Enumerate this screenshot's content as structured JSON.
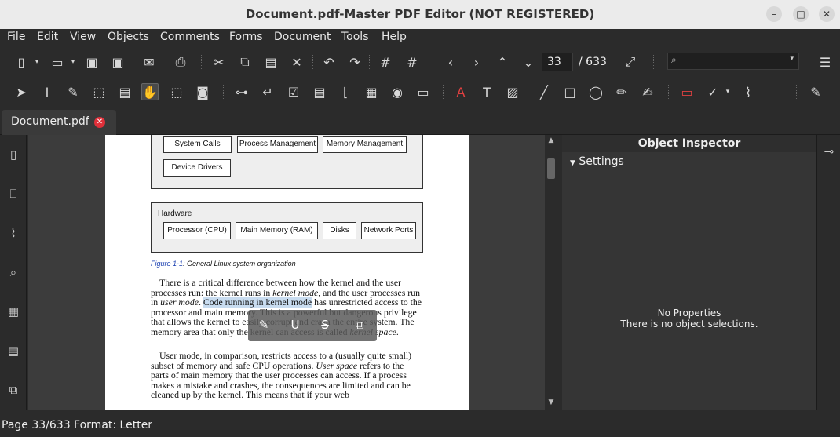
{
  "window": {
    "title": "Document.pdf-Master PDF Editor (NOT REGISTERED)",
    "minimize": "–",
    "maximize": "□",
    "close": "✕"
  },
  "menu": [
    "File",
    "Edit",
    "View",
    "Objects",
    "Comments",
    "Forms",
    "Document",
    "Tools",
    "Help"
  ],
  "toolbar": {
    "page_value": "33",
    "page_total": "/ 633",
    "search_placeholder": ""
  },
  "tab": {
    "label": "Document.pdf",
    "close": "✕"
  },
  "document": {
    "pills_top": [
      "System Calls",
      "Process Management",
      "Memory Management",
      "Device Drivers"
    ],
    "hardware_label": "Hardware",
    "pills_hw": [
      "Processor (CPU)",
      "Main Memory (RAM)",
      "Disks",
      "Network Ports"
    ],
    "caption_fig": "Figure 1-1",
    "caption_text": ": General Linux system organization",
    "p1_a": "There is a critical difference between how the kernel and the user processes run: the kernel runs in ",
    "p1_b": "kernel mode",
    "p1_c": ", and the user processes run in ",
    "p1_d": "user mode",
    "p1_e": ". ",
    "p1_f": "Code running in kernel mode",
    "p1_g": " has unrestricted access to the processor and main memory. This is a powerful but dangerous privilege that allows the kernel to easily corrupt and crash the entire system. The memory area that only the kernel can access is called ",
    "p1_h": "kernel space",
    "p1_i": ".",
    "p2_a": "User mode, in comparison, restricts access to a (usually quite small) subset of memory and safe CPU operations. ",
    "p2_b": "User space",
    "p2_c": " refers to the parts of main memory that the user processes can access. If a process makes a mistake and crashes, the consequences are limited and can be cleaned up by the kernel. This means that if your web"
  },
  "inspector": {
    "title": "Object Inspector",
    "settings": "Settings",
    "no_props": "No Properties",
    "no_sel": "There is no object selections."
  },
  "status": {
    "text": "Page 33/633 Format: Letter"
  },
  "colors": {
    "highlight": "#c8dcf0",
    "tab_close": "#e0303a",
    "caption_link": "#1a3fb0"
  }
}
